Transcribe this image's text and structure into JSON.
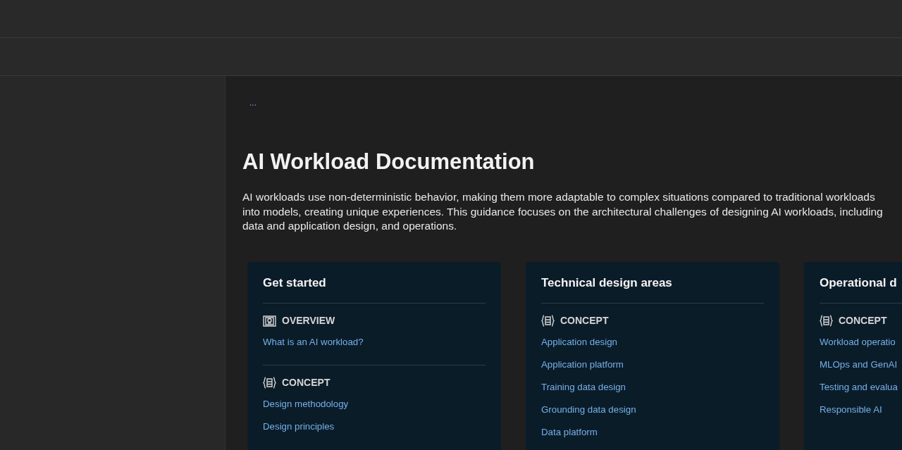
{
  "breadcrumb": {
    "more": "..."
  },
  "title": "AI Workload Documentation",
  "intro_lines": [
    "AI workloads use non-deterministic behavior, making them more adaptable to complex situations compared to traditional workloads",
    "into models, creating unique experiences. This guidance focuses on the architectural challenges of designing AI workloads, including",
    "data and application design, and operations."
  ],
  "cards": [
    {
      "title": "Get started",
      "sections": [
        {
          "kind": "overview",
          "label": "OVERVIEW",
          "links": [
            "What is an AI workload?"
          ]
        },
        {
          "kind": "concept",
          "label": "CONCEPT",
          "links": [
            "Design methodology",
            "Design principles"
          ]
        }
      ]
    },
    {
      "title": "Technical design areas",
      "sections": [
        {
          "kind": "concept",
          "label": "CONCEPT",
          "links": [
            "Application design",
            "Application platform",
            "Training data design",
            "Grounding data design",
            "Data platform"
          ]
        }
      ]
    },
    {
      "title": "Operational d",
      "sections": [
        {
          "kind": "concept",
          "label": "CONCEPT",
          "links": [
            "Workload operatio",
            "MLOps and GenAI",
            "Testing and evalua",
            "Responsible AI"
          ]
        }
      ]
    }
  ]
}
